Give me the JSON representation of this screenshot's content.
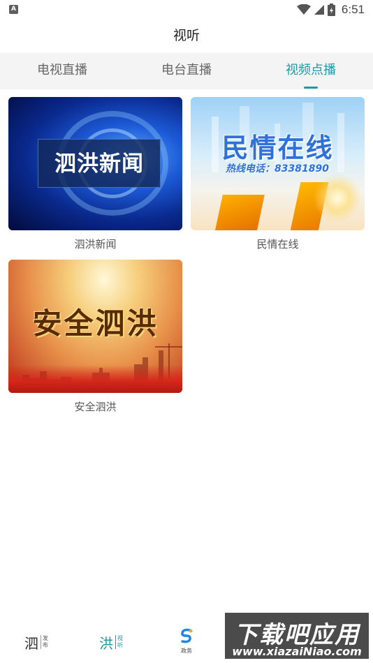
{
  "status_bar": {
    "notification_icon": "a-square-icon",
    "time": "6:51",
    "icons": [
      "wifi-icon",
      "signal-icon",
      "battery-icon"
    ]
  },
  "header": {
    "title": "视听"
  },
  "tabs": [
    {
      "label": "电视直播",
      "active": false
    },
    {
      "label": "电台直播",
      "active": false
    },
    {
      "label": "视频点播",
      "active": true
    }
  ],
  "videos": [
    {
      "label": "泗洪新闻",
      "thumb_text": "泗洪新闻"
    },
    {
      "label": "民情在线",
      "thumb_text": "民情在线",
      "thumb_subtext": "热线电话：83381890"
    },
    {
      "label": "安全泗洪",
      "thumb_text": "安全泗洪"
    }
  ],
  "bottom_nav": [
    {
      "big": "泗",
      "small_top": "发",
      "small_bottom": "布",
      "active": false
    },
    {
      "big": "洪",
      "small_top": "视",
      "small_bottom": "听",
      "active": true
    },
    {
      "icon": "zhengwu-s-logo-icon",
      "label": "政务",
      "active": false
    }
  ],
  "watermark": {
    "main": "下载吧应用",
    "url": "www.xiazaiNiao.com"
  },
  "colors": {
    "accent": "#1f98a8",
    "tab_bar_bg": "#f4f4f4"
  }
}
